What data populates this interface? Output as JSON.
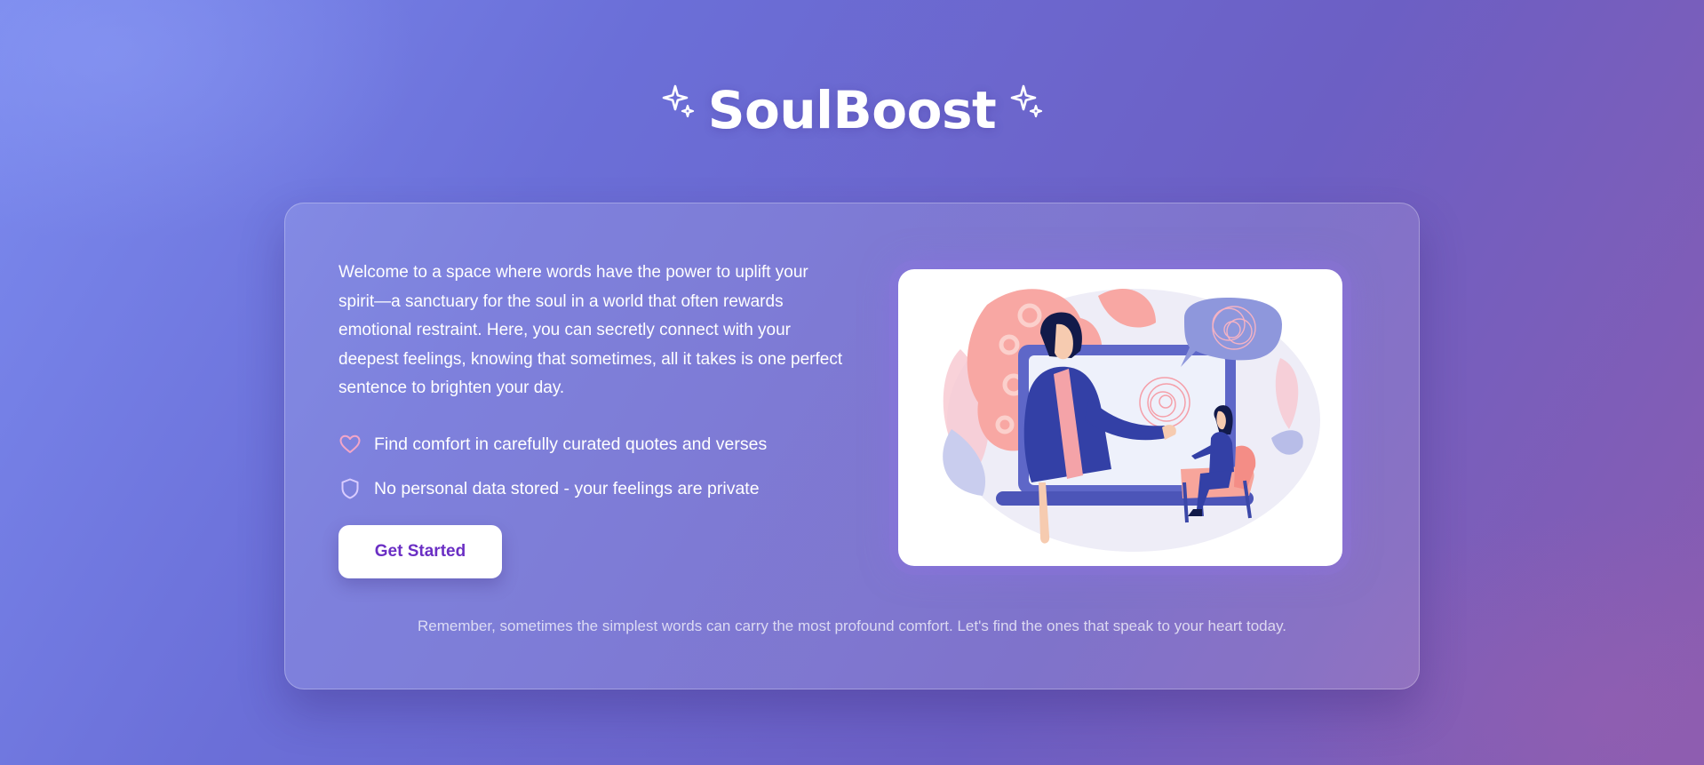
{
  "app": {
    "title": "SoulBoost"
  },
  "card": {
    "intro": "Welcome to a space where words have the power to uplift your spirit—a sanctuary for the soul in a world that often rewards emotional restraint. Here, you can secretly connect with your deepest feelings, knowing that sometimes, all it takes is one perfect sentence to brighten your day.",
    "features": [
      {
        "icon": "heart-icon",
        "text": "Find comfort in carefully curated quotes and verses"
      },
      {
        "icon": "shield-icon",
        "text": "No personal data stored - your feelings are private"
      }
    ],
    "cta_label": "Get Started",
    "footer_note": "Remember, sometimes the simplest words can carry the most profound comfort. Let's find the ones that speak to your heart today."
  },
  "colors": {
    "background_start": "#7b8aee",
    "background_end": "#8a5cb0",
    "accent": "#6b2fc4",
    "heart": "#f3a6c8",
    "shield": "#d9ccff"
  }
}
